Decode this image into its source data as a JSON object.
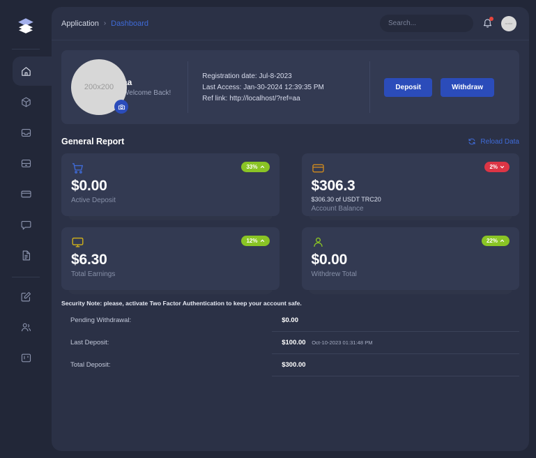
{
  "brand": {
    "logo_icon": "layers-icon"
  },
  "sidebar": {
    "items": [
      {
        "name": "home",
        "icon": "home-icon",
        "active": true
      },
      {
        "name": "packages",
        "icon": "box-icon",
        "active": false
      },
      {
        "name": "inbox",
        "icon": "inbox-icon",
        "active": false
      },
      {
        "name": "archive",
        "icon": "archive-icon",
        "active": false
      },
      {
        "name": "billing",
        "icon": "credit-card-icon",
        "active": false
      },
      {
        "name": "messages",
        "icon": "message-icon",
        "active": false
      },
      {
        "name": "documents",
        "icon": "file-text-icon",
        "active": false
      },
      {
        "name": "compose",
        "icon": "square-pen-icon",
        "active": false
      },
      {
        "name": "users",
        "icon": "users-icon",
        "active": false
      },
      {
        "name": "boards",
        "icon": "kanban-icon",
        "active": false
      }
    ]
  },
  "header": {
    "breadcrumb_root": "Application",
    "breadcrumb_separator": "›",
    "breadcrumb_current": "Dashboard",
    "search_placeholder": "Search...",
    "search_value": "",
    "search_icon": "search-icon",
    "notifications_icon": "bell-icon",
    "has_notification": true,
    "avatar_text": "avatar"
  },
  "profile": {
    "avatar_placeholder": "200x200",
    "camera_icon": "camera-icon",
    "username": "aa",
    "welcome": "Welcome Back!",
    "registration_date": "Registration date: Jul-8-2023",
    "last_access": "Last Access: Jan-30-2024 12:39:35 PM",
    "ref_link": "Ref link: http://localhost/?ref=aa",
    "deposit_label": "Deposit",
    "withdraw_label": "Withdraw"
  },
  "report": {
    "title": "General Report",
    "reload_label": "Reload Data",
    "reload_icon": "refresh-icon",
    "cards": [
      {
        "icon": "shopping-cart-icon",
        "icon_color": "#3f6bd8",
        "badge_value": "33%",
        "badge_direction": "up",
        "value": "$0.00",
        "sub": "",
        "label": "Active Deposit"
      },
      {
        "icon": "credit-card-icon",
        "icon_color": "#d08a1e",
        "badge_value": "2%",
        "badge_direction": "down",
        "value": "$306.3",
        "sub": "$306.30 of USDT TRC20",
        "label": "Account Balance"
      },
      {
        "icon": "monitor-icon",
        "icon_color": "#d4b319",
        "badge_value": "12%",
        "badge_direction": "up",
        "value": "$6.30",
        "sub": "",
        "label": "Total Earnings"
      },
      {
        "icon": "user-icon",
        "icon_color": "#8ac425",
        "badge_value": "22%",
        "badge_direction": "up",
        "value": "$0.00",
        "sub": "",
        "label": "Withdrew Total"
      }
    ]
  },
  "security_note": "Security Note: please, activate Two Factor Authentication to keep your account safe.",
  "summary_rows": [
    {
      "label": "Pending Withdrawal:",
      "value": "$0.00",
      "timestamp": ""
    },
    {
      "label": "Last Deposit:",
      "value": "$100.00",
      "timestamp": "Oct-10-2023 01:31:48 PM"
    },
    {
      "label": "Total Deposit:",
      "value": "$300.00",
      "timestamp": ""
    }
  ],
  "colors": {
    "page_bg": "#222738",
    "panel_bg": "#2b3146",
    "card_bg": "#333a52",
    "accent": "#2b4cba",
    "link": "#3f6bd8",
    "badge_up": "#8ac425",
    "badge_down": "#dc3545"
  }
}
